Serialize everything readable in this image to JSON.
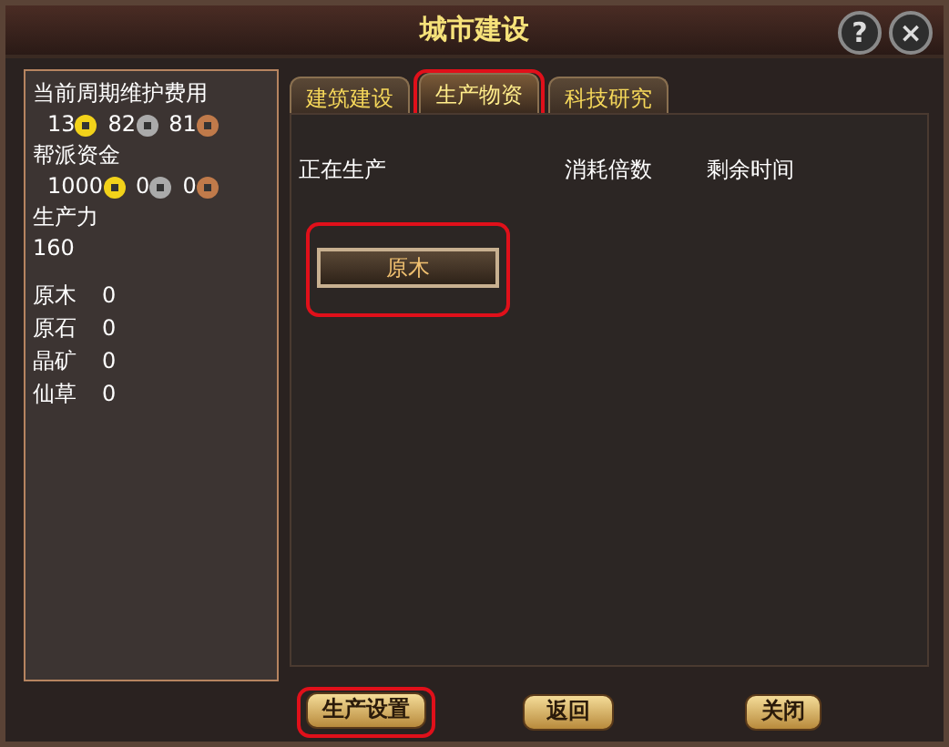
{
  "window": {
    "title": "城市建设",
    "help_button": "?",
    "close_button": "×"
  },
  "sidebar": {
    "upkeep_label": "当前周期维护费用",
    "upkeep": [
      {
        "amount": "13",
        "kind": "gold"
      },
      {
        "amount": "82",
        "kind": "silver"
      },
      {
        "amount": "81",
        "kind": "copper"
      }
    ],
    "funds_label": "帮派资金",
    "funds": [
      {
        "amount": "1000",
        "kind": "gold"
      },
      {
        "amount": "0",
        "kind": "silver"
      },
      {
        "amount": "0",
        "kind": "copper"
      }
    ],
    "productivity_label": "生产力",
    "productivity": "160",
    "materials": [
      {
        "name": "原木",
        "count": "0"
      },
      {
        "name": "原石",
        "count": "0"
      },
      {
        "name": "晶矿",
        "count": "0"
      },
      {
        "name": "仙草",
        "count": "0"
      }
    ]
  },
  "tabs": [
    {
      "label": "建筑建设",
      "selected": false,
      "highlighted": false
    },
    {
      "label": "生产物资",
      "selected": true,
      "highlighted": true
    },
    {
      "label": "科技研究",
      "selected": false,
      "highlighted": false
    }
  ],
  "table": {
    "columns": [
      "正在生产",
      "消耗倍数",
      "剩余时间"
    ]
  },
  "items": [
    {
      "label": "原木",
      "highlighted": true
    }
  ],
  "buttons": [
    {
      "label": "生产设置",
      "highlighted": true
    },
    {
      "label": "返回",
      "highlighted": false
    },
    {
      "label": "关闭",
      "highlighted": false
    }
  ]
}
